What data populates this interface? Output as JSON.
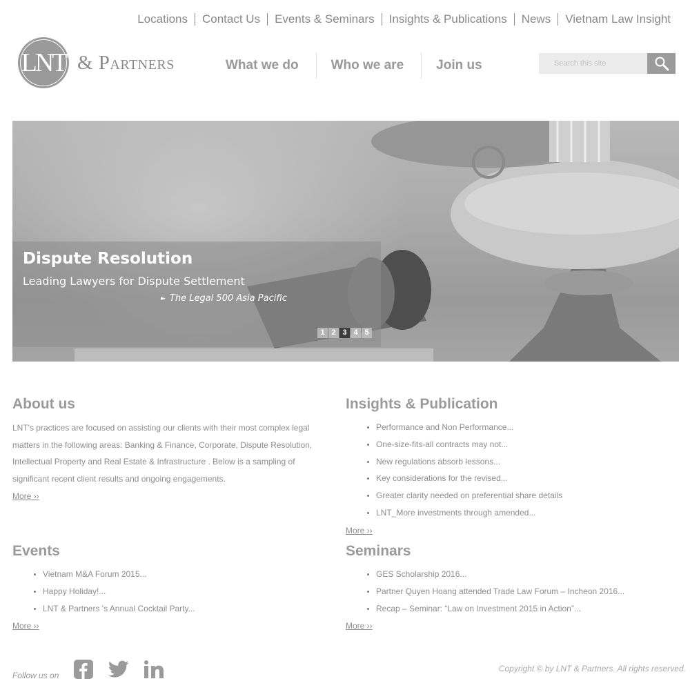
{
  "top_links": [
    "Locations",
    "Contact Us",
    "Events & Seminars",
    "Insights & Publications",
    "News",
    "Vietnam Law Insight"
  ],
  "logo": {
    "mark": "LNT",
    "text": "& Partners"
  },
  "main_nav": [
    "What we do",
    "Who we are",
    "Join us"
  ],
  "search": {
    "placeholder": "Search this site",
    "icon": "search-icon"
  },
  "hero": {
    "title": "Dispute Resolution",
    "subtitle": "Leading Lawyers for Dispute Settlement",
    "source": "The Legal 500 Asia Pacific",
    "slides": [
      "1",
      "2",
      "3",
      "4",
      "5"
    ],
    "active_slide": "3"
  },
  "about": {
    "heading": "About us",
    "body": "LNT's practices are focused on assisting our clients with their most complex legal matters in the following areas: Banking & Finance, Corporate, Dispute Resolution, Intellectual Property and Real Estate & Infrastructure . Below is a sampling of significant recent client results and ongoing engagements.",
    "more": "More ››"
  },
  "insights": {
    "heading": "Insights & Publication",
    "items": [
      "Performance and Non Performance...",
      "One-size-fits-all contracts may not...",
      "New regulations absorb lessons...",
      "Key considerations for the revised...",
      "Greater clarity needed on preferential share details",
      "LNT_More investments through amended..."
    ],
    "more": "More ››"
  },
  "events": {
    "heading": "Events",
    "items": [
      "Vietnam M&A Forum 2015...",
      "Happy Holiday!...",
      "LNT & Partners 's Annual Cocktail Party..."
    ],
    "more": "More ››"
  },
  "seminars": {
    "heading": "Seminars",
    "items": [
      "GES Scholarship 2016...",
      "Partner Quyen Hoang attended Trade Law Forum – Incheon 2016...",
      "Recap – Seminar: “Law on Investment 2015 in Action”..."
    ],
    "more": "More ››"
  },
  "footer": {
    "follow_label": "Follow us on",
    "social": [
      "facebook-icon",
      "twitter-icon",
      "linkedin-icon"
    ],
    "copyright": "Copyright © by LNT & Partners. All rights reserved."
  }
}
